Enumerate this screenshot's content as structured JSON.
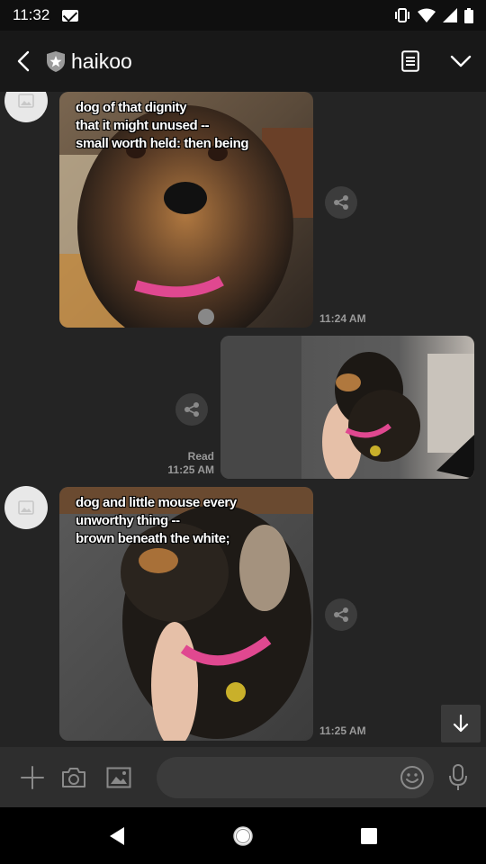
{
  "status_bar": {
    "time": "11:32"
  },
  "header": {
    "title": "haikoo",
    "icons": [
      "back-arrow",
      "shield-star-badge",
      "notes-icon",
      "chevron-down-icon"
    ]
  },
  "messages": [
    {
      "direction": "incoming",
      "caption": "dog of that dignity\nthat it might unused --\nsmall worth held: then being",
      "time": "11:24 AM",
      "read": ""
    },
    {
      "direction": "outgoing",
      "caption": "",
      "time": "11:25 AM",
      "read": "Read"
    },
    {
      "direction": "incoming",
      "caption": "dog and little mouse every\nunworthy thing --\nbrown beneath the white;",
      "time": "11:25 AM",
      "read": ""
    }
  ],
  "composer": {
    "value": "",
    "placeholder": "",
    "icons": [
      "plus-icon",
      "camera-icon",
      "image-icon",
      "emoji-icon",
      "microphone-icon"
    ]
  },
  "colors": {
    "background": "#242424",
    "header": "#181818",
    "input_bar": "#2e2e2e",
    "meta_text": "#9a9a9a"
  }
}
